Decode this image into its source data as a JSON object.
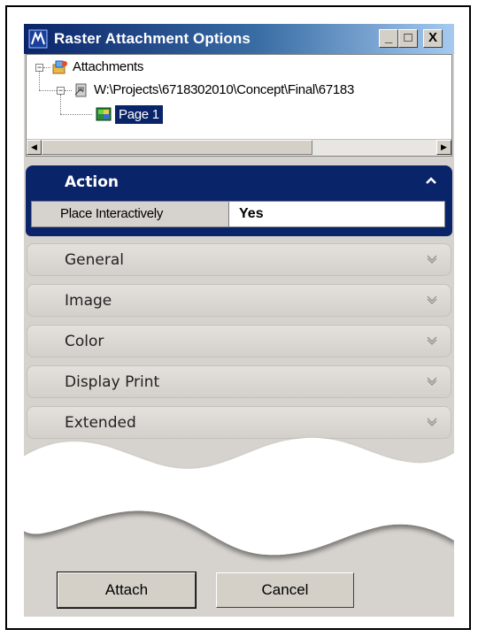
{
  "window": {
    "title": "Raster Attachment Options",
    "controls": {
      "minimize": "_",
      "maximize": "□",
      "close": "X"
    }
  },
  "tree": {
    "root_label": "Attachments",
    "child_label": "W:\\Projects\\6718302010\\Concept\\Final\\67183",
    "leaf_label": "Page 1",
    "expand_symbol": "−"
  },
  "action_section": {
    "label": "Action",
    "row": {
      "label": "Place Interactively",
      "value": "Yes"
    }
  },
  "sections": [
    {
      "label": "General"
    },
    {
      "label": "Image"
    },
    {
      "label": "Color"
    },
    {
      "label": "Display Print"
    },
    {
      "label": "Extended"
    }
  ],
  "buttons": {
    "attach": "Attach",
    "cancel": "Cancel"
  },
  "colors": {
    "title_bar": "#0a246a",
    "selected": "#0a246a",
    "dialog_bg": "#d6d3ce"
  }
}
